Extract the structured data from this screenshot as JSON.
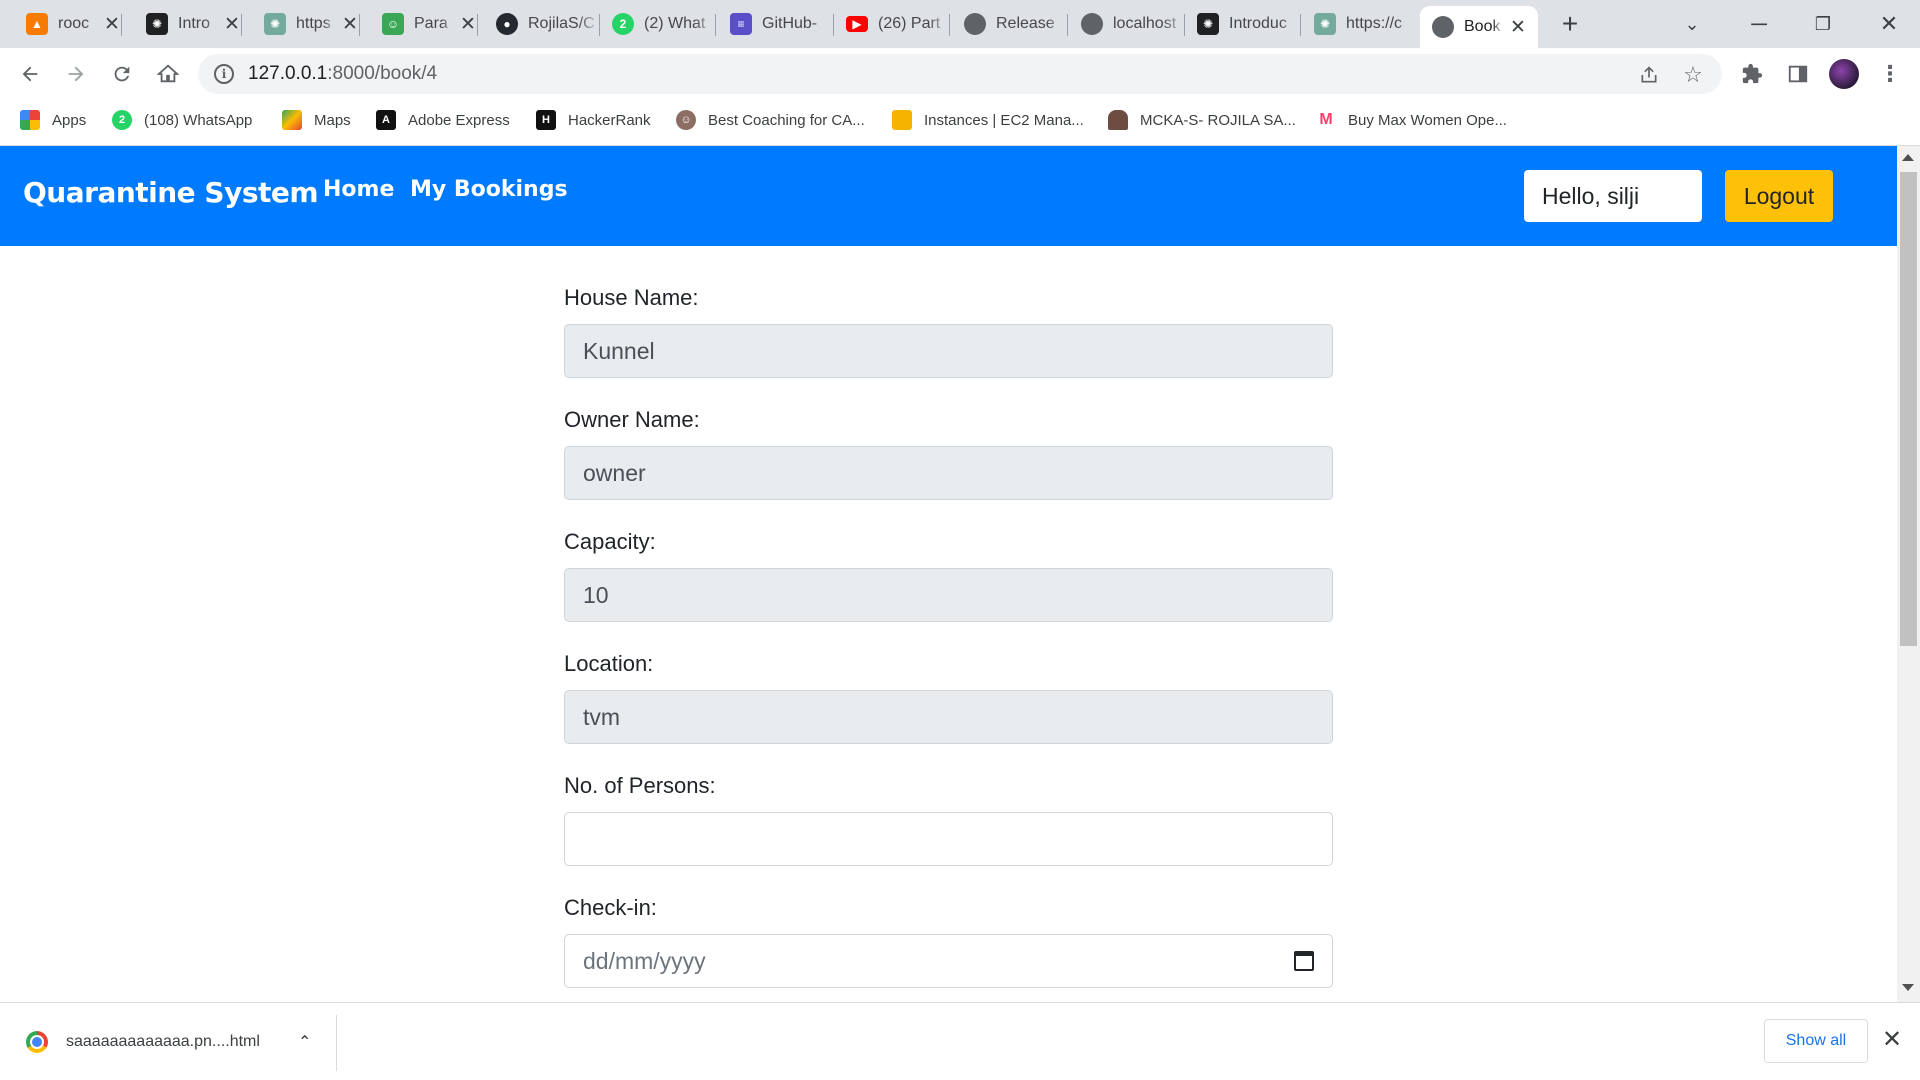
{
  "browser": {
    "tabs": [
      {
        "title": "rooc",
        "icon": "app-icon",
        "color": "#f57c00"
      },
      {
        "title": "Intro",
        "icon": "openai-icon",
        "color": "#202123"
      },
      {
        "title": "https",
        "icon": "chatgpt-icon",
        "color": "#74aa9c"
      },
      {
        "title": "Para",
        "icon": "robot-icon",
        "color": "#3aa757"
      },
      {
        "title": "RojilaS/C",
        "icon": "github-icon",
        "color": "#24292f"
      },
      {
        "title": "(2) What",
        "icon": "whatsapp-icon",
        "color": "#25d366"
      },
      {
        "title": "GitHub-",
        "icon": "list-icon",
        "color": "#5b4fc9"
      },
      {
        "title": "(26) Part",
        "icon": "youtube-icon",
        "color": "#ff0000"
      },
      {
        "title": "Release",
        "icon": "globe-icon",
        "color": "#5f6368"
      },
      {
        "title": "localhost",
        "icon": "globe-icon",
        "color": "#5f6368"
      },
      {
        "title": "Introduc",
        "icon": "openai-icon",
        "color": "#202123"
      },
      {
        "title": "https://c",
        "icon": "chatgpt-icon",
        "color": "#74aa9c"
      },
      {
        "title": "Book",
        "icon": "globe-icon",
        "color": "#5f6368",
        "active": true
      }
    ],
    "url": {
      "host": "127.0.0.1",
      "rest": ":8000/book/4"
    },
    "bookmarks": [
      {
        "label": "Apps",
        "icon": "apps-grid-icon",
        "color": "#ea4335"
      },
      {
        "label": "(108) WhatsApp",
        "icon": "whatsapp-icon",
        "color": "#25d366"
      },
      {
        "label": "Maps",
        "icon": "maps-icon",
        "color": "#34a853"
      },
      {
        "label": "Adobe Express",
        "icon": "adobe-icon",
        "color": "#111111"
      },
      {
        "label": "HackerRank",
        "icon": "hackerrank-icon",
        "color": "#111111"
      },
      {
        "label": "Best Coaching for CA...",
        "icon": "person-icon",
        "color": "#8d6e63"
      },
      {
        "label": "Instances | EC2 Mana...",
        "icon": "aws-box-icon",
        "color": "#f4b400"
      },
      {
        "label": "MCKA-S- ROJILA SA...",
        "icon": "cake-icon",
        "color": "#6d4c41"
      },
      {
        "label": "Buy Max Women Ope...",
        "icon": "myntra-icon",
        "color": "#ff3f6c"
      }
    ]
  },
  "app": {
    "brand": "Quarantine System",
    "nav": {
      "home": "Home",
      "bookings": "My Bookings"
    },
    "greeting": "Hello, silji",
    "logout": "Logout",
    "colors": {
      "navbar": "#007bff",
      "logout": "#ffc107"
    }
  },
  "form": {
    "house_name": {
      "label": "House Name:",
      "value": "Kunnel"
    },
    "owner_name": {
      "label": "Owner Name:",
      "value": "owner"
    },
    "capacity": {
      "label": "Capacity:",
      "value": "10"
    },
    "location": {
      "label": "Location:",
      "value": "tvm"
    },
    "persons": {
      "label": "No. of Persons:",
      "value": ""
    },
    "checkin": {
      "label": "Check-in:",
      "placeholder": "dd/mm/yyyy"
    }
  },
  "downloads": {
    "file": "saaaaaaaaaaaaa.pn....html",
    "show_all": "Show all"
  }
}
